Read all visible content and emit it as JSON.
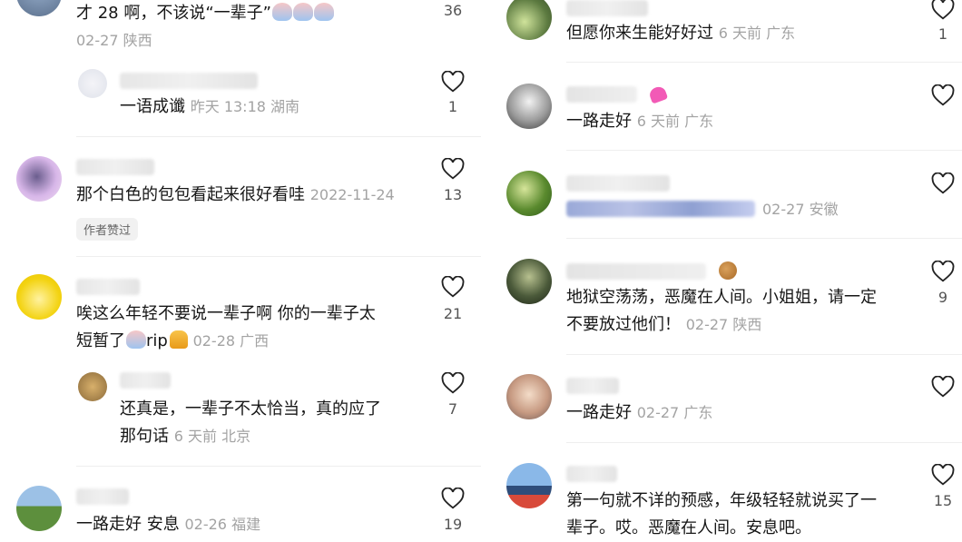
{
  "left": {
    "c0": {
      "text": "才 28 啊，不该说“一辈子”",
      "date": "02-27",
      "location": "陕西",
      "likes": "36"
    },
    "c0r": {
      "text": "一语成谶",
      "time": "昨天 13:18",
      "location": "湖南",
      "likes": "1"
    },
    "c1": {
      "text": "那个白色的包包看起来很好看哇",
      "date": "2022-11-24",
      "likes": "13",
      "chip": "作者赞过"
    },
    "c2": {
      "text1": "唉这么年轻不要说一辈子啊 你的一辈子太",
      "text2a": "短暂了",
      "text2b": "rip",
      "date": "02-28",
      "location": "广西",
      "likes": "21"
    },
    "c2r": {
      "text1": "还真是，一辈子不太恰当，真的应了",
      "text2": "那句话",
      "time": "6 天前",
      "location": "北京",
      "likes": "7"
    },
    "c3": {
      "text": "一路走好 安息",
      "date": "02-26",
      "location": "福建",
      "likes": "19"
    }
  },
  "right": {
    "c0": {
      "text": "但愿你来生能好好过",
      "time": "6 天前",
      "location": "广东",
      "likes": "1"
    },
    "c1": {
      "text": "一路走好",
      "time": "6 天前",
      "location": "广东"
    },
    "c2": {
      "date": "02-27",
      "location": "安徽"
    },
    "c3": {
      "text1": "地狱空荡荡，恶魔在人间。小姐姐，请一定",
      "text2": "不要放过他们！",
      "date": "02-27",
      "location": "陕西",
      "likes": "9"
    },
    "c4": {
      "text": "一路走好",
      "date": "02-27",
      "location": "广东"
    },
    "c5": {
      "text1": "第一句就不详的预感，年级轻轻就说买了一",
      "text2": "辈子。哎。恶魔在人间。安息吧。",
      "likes": "15"
    }
  },
  "icons": {
    "like": "heart-outline-icon"
  }
}
